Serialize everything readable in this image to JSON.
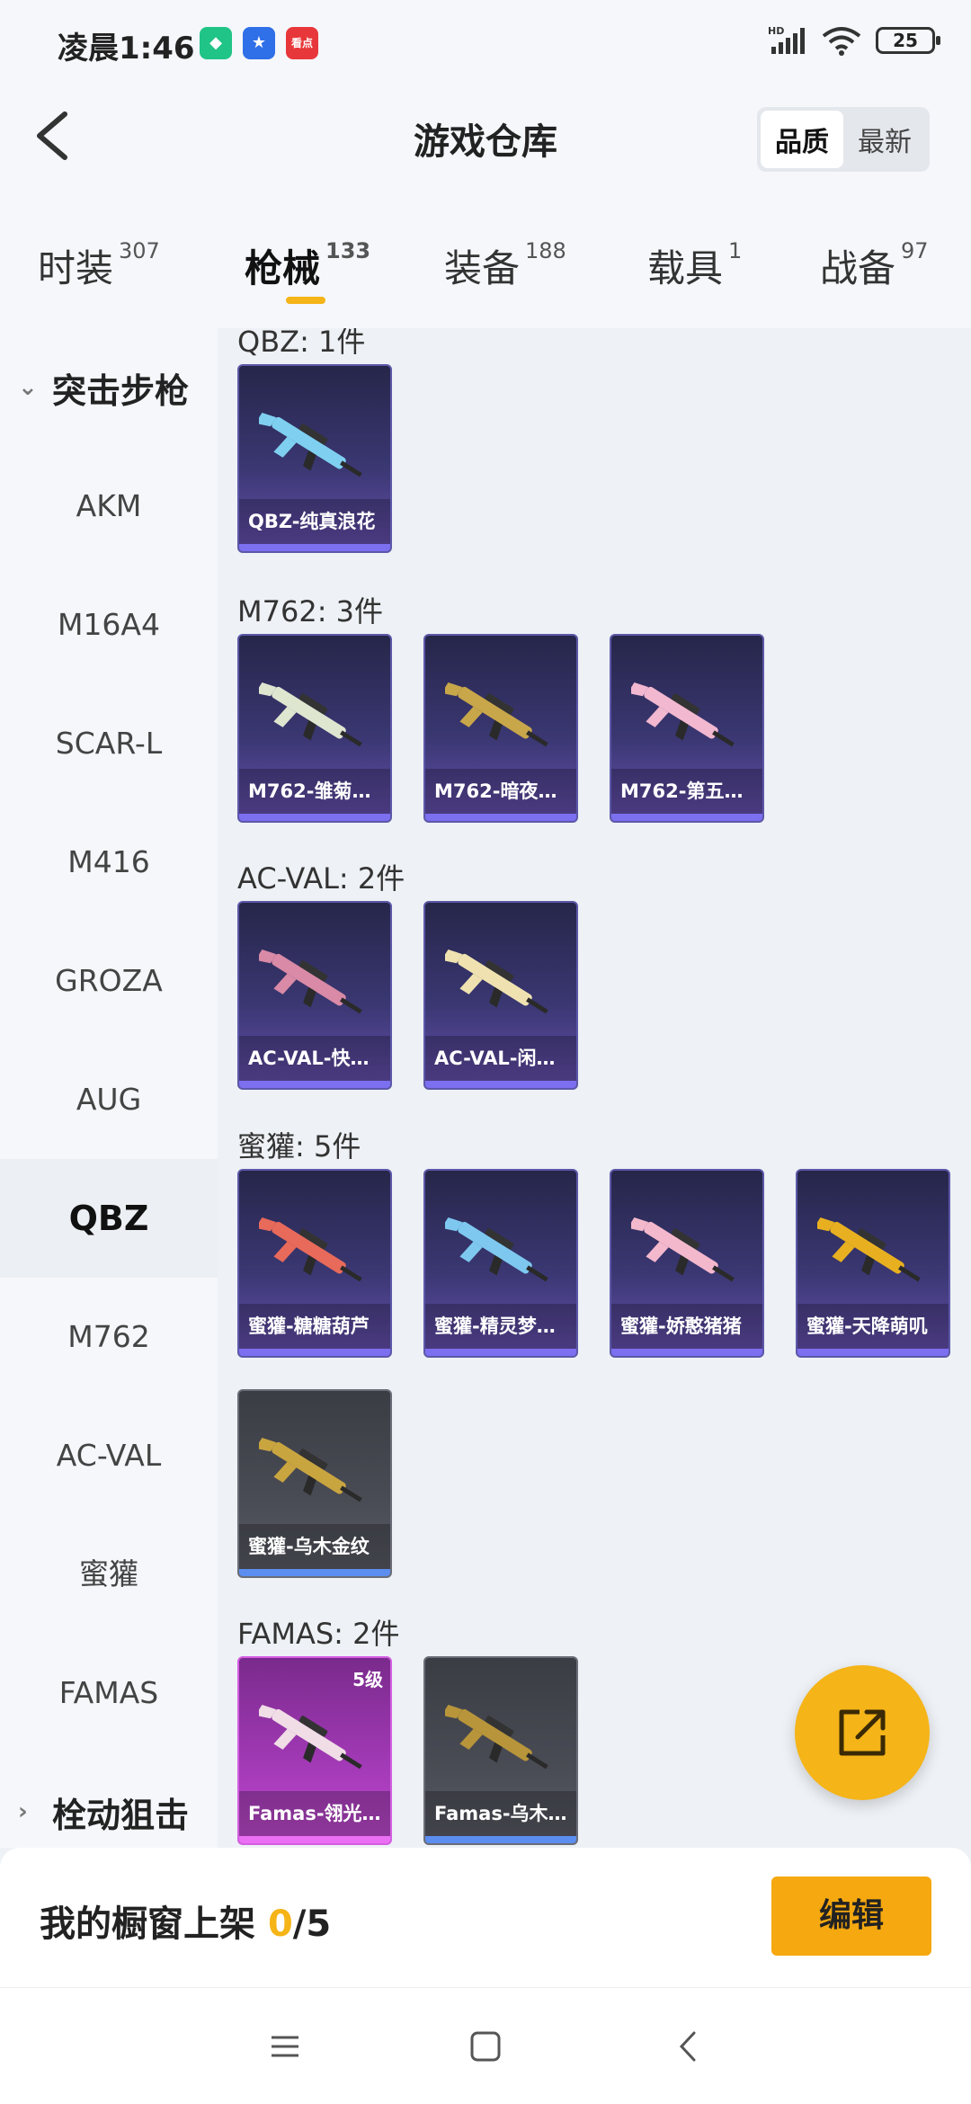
{
  "status_bar": {
    "time": "凌晨1:46",
    "app_icons": [
      {
        "name": "shield-app-icon",
        "color": "#20c486",
        "glyph": "◆"
      },
      {
        "name": "star-app-icon",
        "color": "#2f6fe8",
        "glyph": "★"
      },
      {
        "name": "news-app-icon",
        "color": "#e8373a",
        "glyph": "看点"
      }
    ],
    "network": "HD",
    "battery": "25"
  },
  "header": {
    "title": "游戏仓库",
    "sort_options": [
      "品质",
      "最新"
    ],
    "sort_selected": "品质"
  },
  "tabs": [
    {
      "label": "时装",
      "count": "307"
    },
    {
      "label": "枪械",
      "count": "133",
      "active": true
    },
    {
      "label": "装备",
      "count": "188"
    },
    {
      "label": "载具",
      "count": "1"
    },
    {
      "label": "战备",
      "count": "97"
    }
  ],
  "sidebar": {
    "group_expanded": "突击步枪",
    "items": [
      "AKM",
      "M16A4",
      "SCAR-L",
      "M416",
      "GROZA",
      "AUG",
      "QBZ",
      "M762",
      "AC-VAL",
      "蜜獾",
      "FAMAS"
    ],
    "active": "QBZ",
    "group_collapsed": "栓动狙击"
  },
  "sections": [
    {
      "title": "QBZ: 1件",
      "items": [
        {
          "label": "QBZ-纯真浪花",
          "style": "purple",
          "gun_color": "#7fd0f0"
        }
      ]
    },
    {
      "title": "M762: 3件",
      "items": [
        {
          "label": "M762-雏菊…",
          "style": "purple",
          "gun_color": "#dfe6d0"
        },
        {
          "label": "M762-暗夜…",
          "style": "purple",
          "gun_color": "#c8a64a"
        },
        {
          "label": "M762-第五…",
          "style": "purple",
          "gun_color": "#f2b8d0"
        }
      ]
    },
    {
      "title": "AC-VAL: 2件",
      "items": [
        {
          "label": "AC-VAL-快…",
          "style": "purple",
          "gun_color": "#d98aa6"
        },
        {
          "label": "AC-VAL-闲…",
          "style": "purple",
          "gun_color": "#efe2b0"
        }
      ]
    },
    {
      "title": "蜜獾: 5件",
      "items": [
        {
          "label": "蜜獾-糖糖葫芦",
          "style": "purple",
          "gun_color": "#e86a5a"
        },
        {
          "label": "蜜獾-精灵梦…",
          "style": "purple",
          "gun_color": "#7ec8f0"
        },
        {
          "label": "蜜獾-娇憨猪猪",
          "style": "purple",
          "gun_color": "#f4b8cc"
        },
        {
          "label": "蜜獾-天降萌叽",
          "style": "purple",
          "gun_color": "#e8b020"
        },
        {
          "label": "蜜獾-乌木金纹",
          "style": "gray",
          "gun_color": "#c9a540"
        }
      ]
    },
    {
      "title": "FAMAS: 2件",
      "items": [
        {
          "label": "Famas-翎光…",
          "style": "pink",
          "gun_color": "#f0dde6",
          "level": "5级"
        },
        {
          "label": "Famas-乌木…",
          "style": "gray",
          "gun_color": "#b8953a"
        }
      ]
    }
  ],
  "bottom_bar": {
    "label": "我的橱窗上架 ",
    "current": "0",
    "total": "/5",
    "edit_label": "编辑"
  },
  "colors": {
    "accent": "#f5b417",
    "card_purple": "#3a3772",
    "card_gray": "#4a4c55",
    "card_pink": "#a43ab8"
  }
}
